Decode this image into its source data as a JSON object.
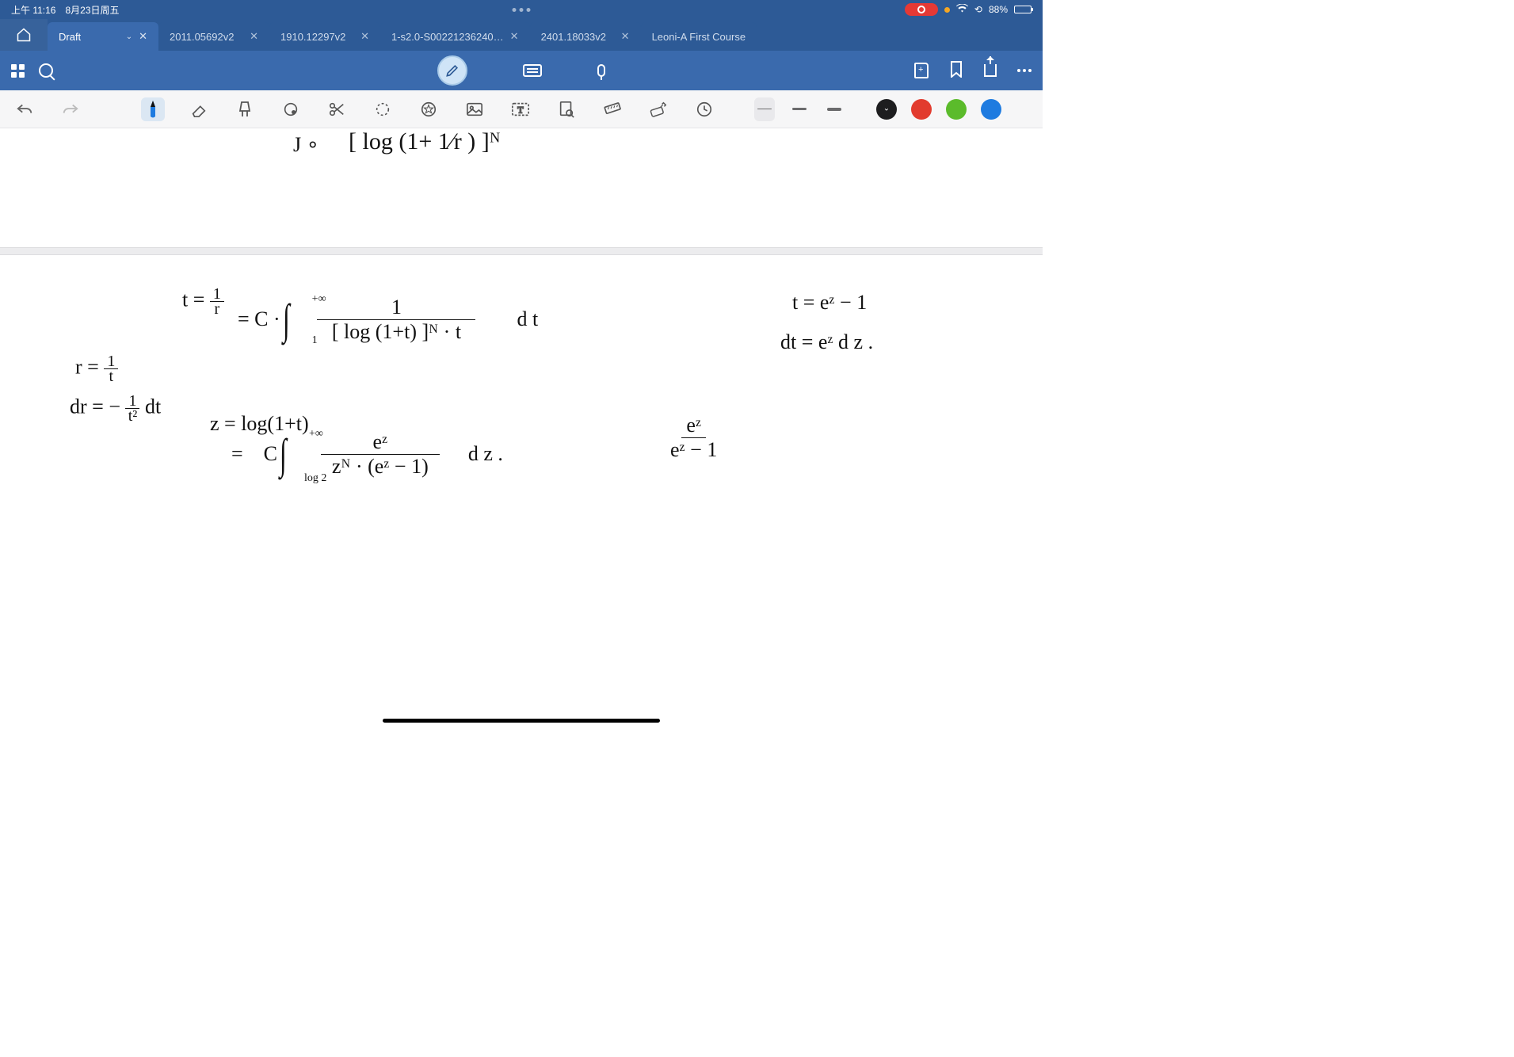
{
  "status": {
    "time": "上午 11:16",
    "date": "8月23日周五",
    "battery_pct": "88%"
  },
  "tabs": {
    "items": [
      {
        "label": "Draft",
        "active": true,
        "has_dropdown": true
      },
      {
        "label": "2011.05692v2",
        "active": false
      },
      {
        "label": "1910.12297v2",
        "active": false
      },
      {
        "label": "1-s2.0-S00221236240…",
        "active": false
      },
      {
        "label": "2401.18033v2",
        "active": false
      },
      {
        "label": "Leoni-A First Course",
        "active": false,
        "no_close": true
      }
    ]
  },
  "toolbar": {
    "tools": [
      "undo",
      "redo",
      "pen",
      "eraser",
      "highlight",
      "shape",
      "cut",
      "lasso",
      "favorite",
      "image",
      "text",
      "search-page",
      "ruler",
      "link",
      "clock"
    ],
    "selected_tool": "pen",
    "strokes": [
      1,
      2,
      3
    ],
    "selected_stroke": 0,
    "colors": [
      "#1d1d1f",
      "#e23b2e",
      "#5bbb2b",
      "#1e7be0"
    ],
    "selected_color": 0
  },
  "handwriting": {
    "line0_left": "J ∘",
    "line0_right": "[ log (1+ 1⁄r ) ]ᴺ",
    "blk1_a": "t = 1⁄r",
    "blk1_b": "r = 1⁄t",
    "blk1_c": "dr = − 1⁄t² dt",
    "blk2_head": "= C ·",
    "blk2_upper": "+∞",
    "blk2_lower": "1",
    "blk2_num": "1",
    "blk2_den": "[ log (1+t) ]ᴺ · t",
    "blk2_tail": "d t",
    "blk3_note": "z = log(1+t)",
    "blk3_head": "=    C",
    "blk3_upper": "+∞",
    "blk3_lower": "log 2",
    "blk3_num": "eᶻ",
    "blk3_den": "zᴺ · (eᶻ − 1)",
    "blk3_tail": "d z .",
    "blk4_num": "eᶻ",
    "blk4_den": "eᶻ − 1",
    "blk5_a": "t = eᶻ − 1",
    "blk5_b": "dt = eᶻ d z ."
  }
}
